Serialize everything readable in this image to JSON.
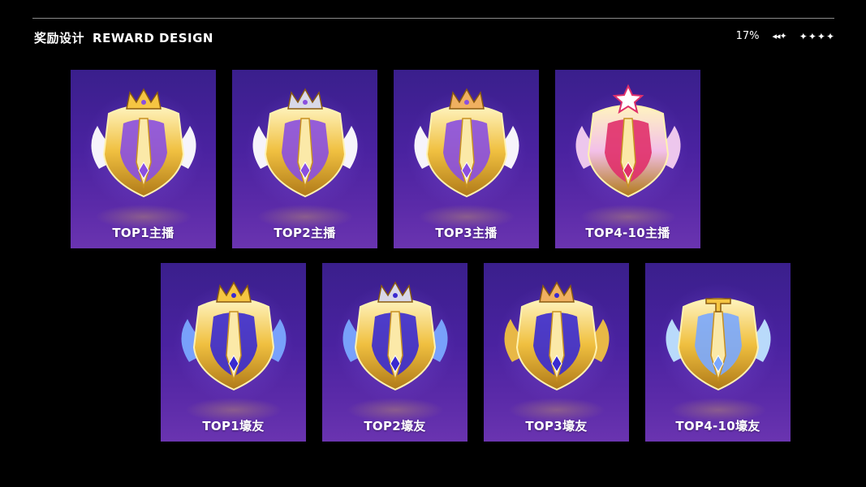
{
  "header": {
    "title_cn": "奖励设计",
    "title_en": "REWARD DESIGN",
    "percent": "17%",
    "nav_glyph": "◂◂✦",
    "stars": "✦✦✦✦"
  },
  "cards": [
    {
      "label": "TOP1主播",
      "metal": "#f0c040",
      "accent": "#8a4fe0",
      "wing": "#ffffff",
      "crown": "gold"
    },
    {
      "label": "TOP2主播",
      "metal": "#f0c040",
      "accent": "#8a4fe0",
      "wing": "#ffffff",
      "crown": "silver"
    },
    {
      "label": "TOP3主播",
      "metal": "#f0c040",
      "accent": "#8a4fe0",
      "wing": "#ffffff",
      "crown": "bronze"
    },
    {
      "label": "TOP4-10主播",
      "metal": "#f3c0e8",
      "accent": "#e0306a",
      "wing": "#f6d0f0",
      "crown": "star"
    },
    {
      "label": "TOP1壕友",
      "metal": "#f0c040",
      "accent": "#3a2ad0",
      "wing": "#7aa8ff",
      "crown": "gold"
    },
    {
      "label": "TOP2壕友",
      "metal": "#f0c040",
      "accent": "#3a2ad0",
      "wing": "#7aa8ff",
      "crown": "silver"
    },
    {
      "label": "TOP3壕友",
      "metal": "#f0c040",
      "accent": "#3a2ad0",
      "wing": "#f0c040",
      "crown": "bronze"
    },
    {
      "label": "TOP4-10壕友",
      "metal": "#f0c040",
      "accent": "#7aa8ff",
      "wing": "#bfe4ff",
      "crown": "none"
    }
  ],
  "colors": {
    "background": "#000000",
    "card_top": "#3a1f8c",
    "card_bottom": "#6a34b0",
    "rule": "#8a8a8a"
  }
}
